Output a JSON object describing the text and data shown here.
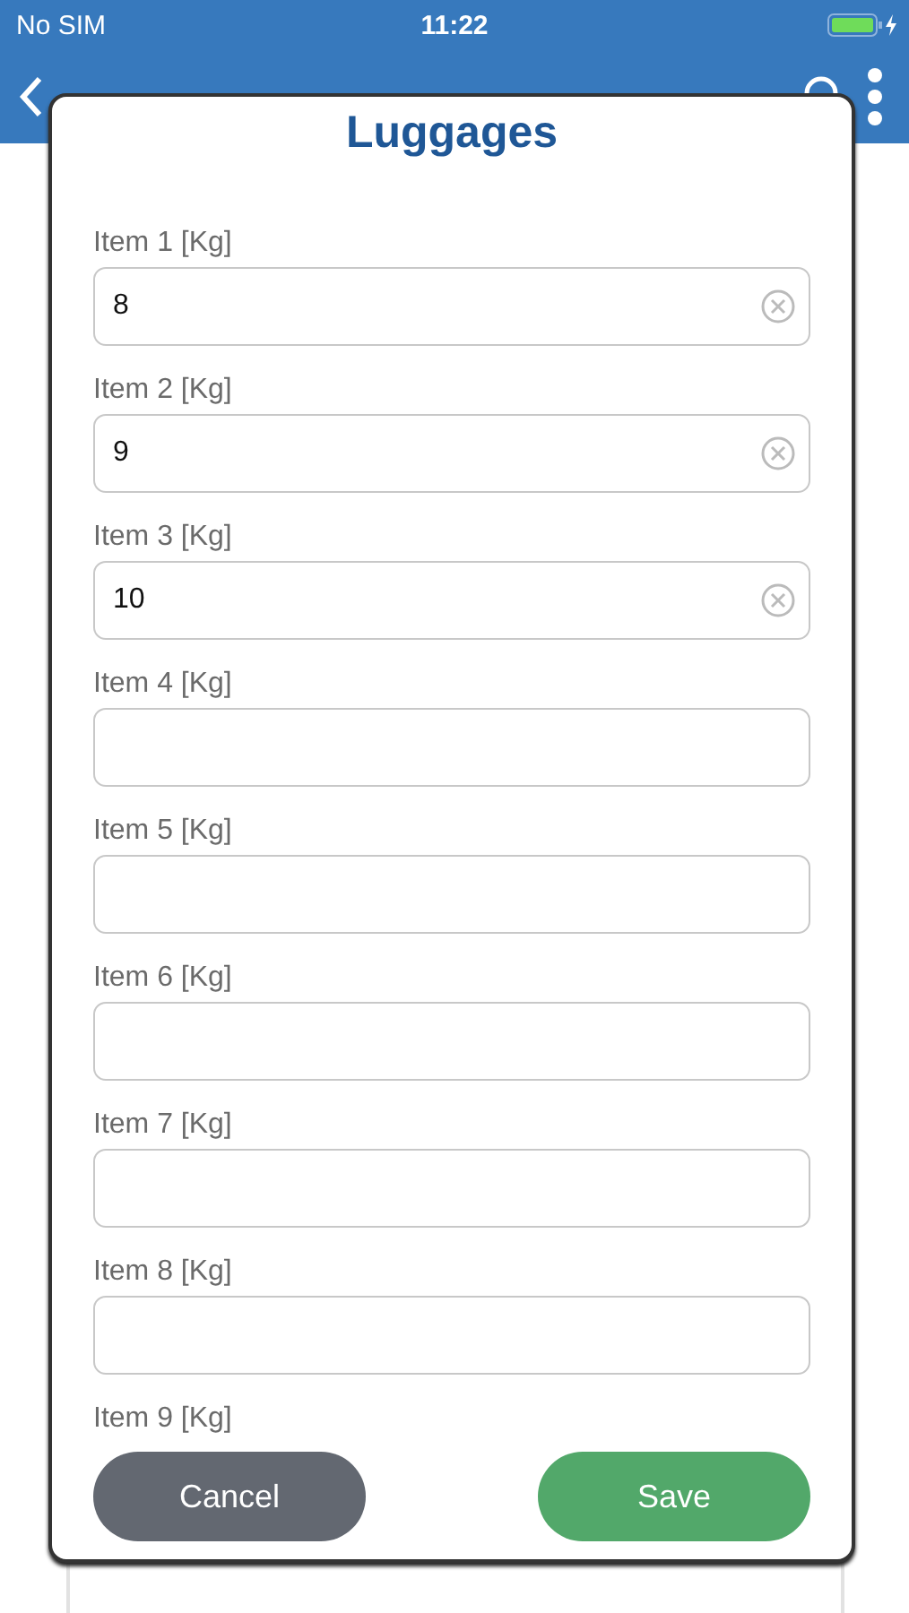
{
  "status_bar": {
    "carrier": "No SIM",
    "time": "11:22"
  },
  "dialog": {
    "title": "Luggages",
    "fields": [
      {
        "label": "Item 1 [Kg]",
        "value": "8"
      },
      {
        "label": "Item 2 [Kg]",
        "value": "9"
      },
      {
        "label": "Item 3 [Kg]",
        "value": "10"
      },
      {
        "label": "Item 4 [Kg]"
      },
      {
        "label": "Item 5 [Kg]"
      },
      {
        "label": "Item 6 [Kg]"
      },
      {
        "label": "Item 7 [Kg]"
      },
      {
        "label": "Item 8 [Kg]"
      }
    ],
    "last_label": "Item 9 [Kg]",
    "buttons": [
      {
        "label": "Cancel",
        "kind": "cancel"
      },
      {
        "label": "Save",
        "kind": "save"
      }
    ]
  }
}
